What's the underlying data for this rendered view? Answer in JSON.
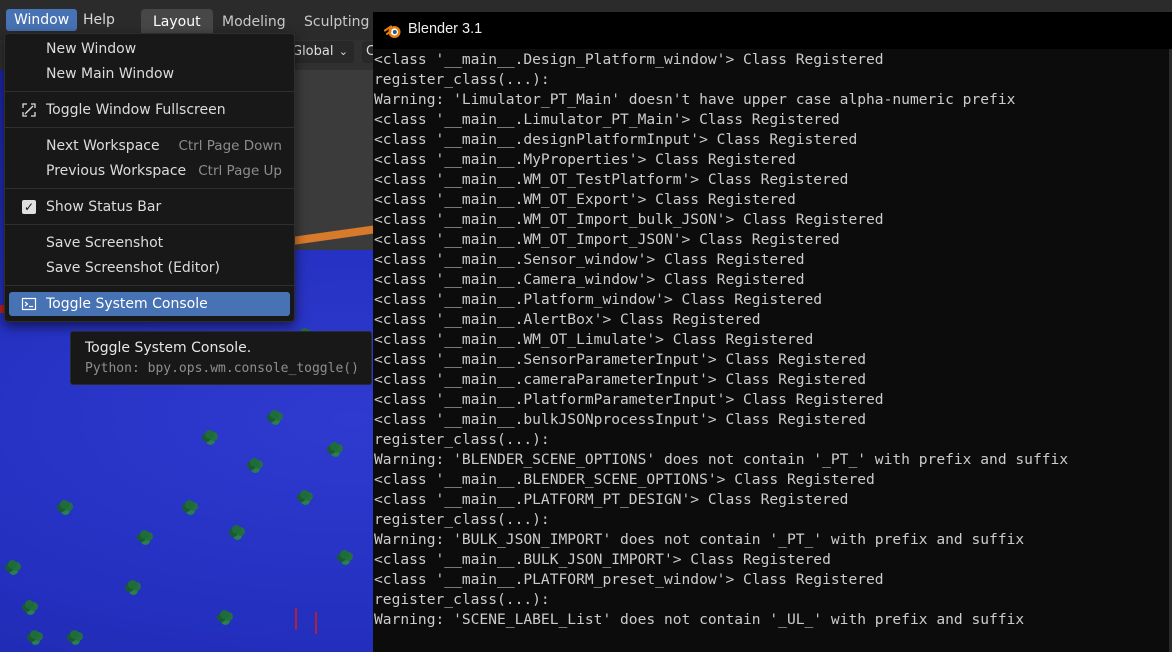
{
  "topbar": {
    "menus": {
      "window": "Window",
      "help": "Help"
    },
    "workspace_tabs": {
      "layout": "Layout",
      "modeling": "Modeling",
      "sculpting": "Sculpting"
    }
  },
  "viewport_header": {
    "orientation": "Global",
    "partial_next": "C"
  },
  "window_menu": {
    "new_window": "New Window",
    "new_main_window": "New Main Window",
    "toggle_fullscreen": "Toggle Window Fullscreen",
    "next_workspace": "Next Workspace",
    "next_workspace_shortcut": "Ctrl Page Down",
    "previous_workspace": "Previous Workspace",
    "previous_workspace_shortcut": "Ctrl Page Up",
    "show_status_bar": "Show Status Bar",
    "show_status_bar_checked": true,
    "save_screenshot": "Save Screenshot",
    "save_screenshot_editor": "Save Screenshot (Editor)",
    "toggle_system_console": "Toggle System Console"
  },
  "tooltip": {
    "title": "Toggle System Console.",
    "python": "Python: bpy.ops.wm.console_toggle()"
  },
  "console": {
    "title": "Blender 3.1",
    "lines": [
      "<class '__main__.Design_Platform_window'> Class Registered",
      "register_class(...):",
      "Warning: 'Limulator_PT_Main' doesn't have upper case alpha-numeric prefix",
      "<class '__main__.Limulator_PT_Main'> Class Registered",
      "<class '__main__.designPlatformInput'> Class Registered",
      "<class '__main__.MyProperties'> Class Registered",
      "<class '__main__.WM_OT_TestPlatform'> Class Registered",
      "<class '__main__.WM_OT_Export'> Class Registered",
      "<class '__main__.WM_OT_Import_bulk_JSON'> Class Registered",
      "<class '__main__.WM_OT_Import_JSON'> Class Registered",
      "<class '__main__.Sensor_window'> Class Registered",
      "<class '__main__.Camera_window'> Class Registered",
      "<class '__main__.Platform_window'> Class Registered",
      "<class '__main__.AlertBox'> Class Registered",
      "<class '__main__.WM_OT_Limulate'> Class Registered",
      "<class '__main__.SensorParameterInput'> Class Registered",
      "<class '__main__.cameraParameterInput'> Class Registered",
      "<class '__main__.PlatformParameterInput'> Class Registered",
      "<class '__main__.bulkJSONprocessInput'> Class Registered",
      "register_class(...):",
      "Warning: 'BLENDER_SCENE_OPTIONS' does not contain '_PT_' with prefix and suffix",
      "<class '__main__.BLENDER_SCENE_OPTIONS'> Class Registered",
      "<class '__main__.PLATFORM_PT_DESIGN'> Class Registered",
      "register_class(...):",
      "Warning: 'BULK_JSON_IMPORT' does not contain '_PT_' with prefix and suffix",
      "<class '__main__.BULK_JSON_IMPORT'> Class Registered",
      "<class '__main__.PLATFORM_preset_window'> Class Registered",
      "register_class(...):",
      "Warning: 'SCENE_LABEL_List' does not contain '_UL_' with prefix and suffix"
    ]
  },
  "colors": {
    "accent_selected": "#4772b3",
    "console_bg": "#0c0c0c",
    "console_text": "#cccccc",
    "viewport_terrain": "#2430c0"
  },
  "icons": {
    "blender_logo": "blender-logo-icon",
    "fullscreen": "fullscreen-icon",
    "console": "console-icon",
    "checkbox": "checkbox-icon"
  }
}
